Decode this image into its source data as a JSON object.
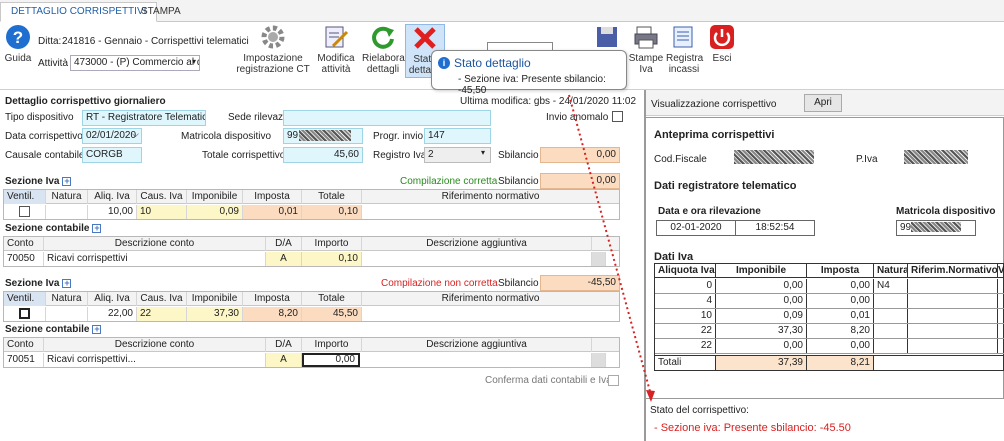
{
  "tabs": [
    {
      "label": "DETTAGLIO CORRISPETTIVI"
    },
    {
      "label": "STAMPA"
    }
  ],
  "toolbar": {
    "guida": "Guida",
    "ditta_label": "Ditta:",
    "ditta_value": "241816 - Gennaio - Corrispettivi telematici",
    "attivita_label": "Attività",
    "attivita_value": "473000 - (P) Commercio al d",
    "impostazione": [
      "Impostazione",
      "registrazione CT"
    ],
    "modifica": [
      "Modifica",
      "attività"
    ],
    "rielabora": [
      "Rielabora",
      "dettagli"
    ],
    "stato": [
      "Stato",
      "dettagli"
    ],
    "stampe": [
      "Stampe",
      "Iva"
    ],
    "registra": [
      "Registra",
      "incassi"
    ],
    "esci": "Esci"
  },
  "tooltip": {
    "title": "Stato dettaglio",
    "text": "- Sezione iva: Presente sbilancio: -45,50"
  },
  "detail": {
    "title": "Dettaglio corrispettivo giornaliero",
    "ultima_modifica": "Ultima modifica: gbs - 24/01/2020 11:02",
    "tipo_label": "Tipo dispositivo",
    "tipo_value": "RT - Registratore Telematico",
    "sede_label": "Sede rilevazione",
    "sede_value": "",
    "invio_label": "Invio anomalo",
    "data_label": "Data corrispettivo",
    "data_value": "02/01/2020",
    "matricola_label": "Matricola dispositivo",
    "matricola_prefix": "99",
    "progr_label": "Progr. invio",
    "progr_value": "147",
    "causale_label": "Causale contabile",
    "causale_value": "CORGB",
    "totale_label": "Totale corrispettivo",
    "totale_value": "45,60",
    "registro_label": "Registro Iva",
    "registro_value": "2",
    "sbilancio_label": "Sbilancio",
    "sbilancio_value": "0,00"
  },
  "iva_headers": [
    "Ventil.",
    "Natura",
    "Aliq. Iva",
    "Caus. Iva",
    "Imponibile",
    "Imposta",
    "Totale",
    "Riferimento normativo"
  ],
  "cont_headers": [
    "Conto",
    "Descrizione conto",
    "D/A",
    "Importo",
    "Descrizione aggiuntiva"
  ],
  "sections": [
    {
      "iva_title": "Sezione Iva",
      "status": "Compilazione corretta",
      "status_color": "#2a8a1f",
      "sbil_label": "Sbilancio",
      "sbil_value": "0,00",
      "iva_row": [
        "",
        "",
        "10,00",
        "10",
        "0,09",
        "0,01",
        "0,10",
        ""
      ],
      "cont_title": "Sezione contabile",
      "cont_row": [
        "70050",
        "Ricavi corrispettivi",
        "A",
        "0,10",
        ""
      ]
    },
    {
      "iva_title": "Sezione Iva",
      "status": "Compilazione non corretta",
      "status_color": "#d62222",
      "sbil_label": "Sbilancio",
      "sbil_value": "-45,50",
      "iva_row": [
        "",
        "",
        "22,00",
        "22",
        "37,30",
        "8,20",
        "45,50",
        ""
      ],
      "cont_title": "Sezione contabile",
      "cont_row": [
        "70051",
        "Ricavi corrispettivi...",
        "A",
        "0,00",
        ""
      ]
    }
  ],
  "conferma": "Conferma dati contabili e Iva",
  "right": {
    "title": "Visualizzazione corrispettivo",
    "apri": "Apri",
    "anteprima": "Anteprima corrispettivi",
    "codfisc_label": "Cod.Fiscale",
    "piva_label": "P.Iva",
    "dati_rt": "Dati registratore telematico",
    "data_ora_label": "Data e ora rilevazione",
    "data": "02-01-2020",
    "ora": "18:52:54",
    "matricola_label": "Matricola dispositivo",
    "matricola_prefix": "99",
    "dati_iva": "Dati Iva",
    "table_headers": [
      "Aliquota Iva",
      "Imponibile",
      "Imposta",
      "Natura",
      "Riferim.Normativo",
      "V"
    ],
    "rows": [
      [
        "0",
        "0,00",
        "0,00",
        "N4",
        ""
      ],
      [
        "4",
        "0,00",
        "0,00",
        "",
        ""
      ],
      [
        "10",
        "0,09",
        "0,01",
        "",
        ""
      ],
      [
        "22",
        "37,30",
        "8,20",
        "",
        ""
      ],
      [
        "22",
        "0,00",
        "0,00",
        "",
        ""
      ]
    ],
    "totali": [
      "Totali",
      "37,39",
      "8,21"
    ],
    "stato_label": "Stato del corrispettivo:",
    "stato_value": "- Sezione iva: Presente sbilancio: -45.50"
  }
}
